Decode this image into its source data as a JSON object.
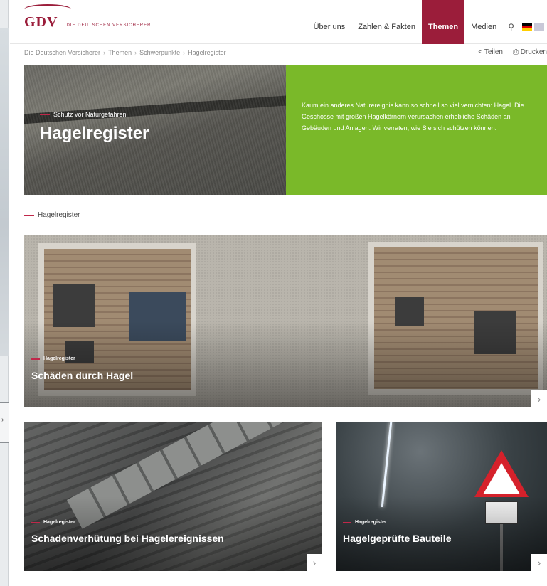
{
  "header": {
    "logo_text": "GDV",
    "logo_sub": "Die Deutschen Versicherer",
    "nav": [
      "Über uns",
      "Zahlen & Fakten",
      "Themen",
      "Medien"
    ],
    "active_nav": "Themen",
    "icons": [
      "search-icon",
      "flag-de-icon",
      "flag-uk-icon"
    ]
  },
  "breadcrumb": [
    "Die Deutschen Versicherer",
    "Themen",
    "Schwerpunkte",
    "Hagelregister"
  ],
  "actions": {
    "share": "Teilen",
    "print": "Drucken"
  },
  "hero": {
    "kicker": "Schutz vor Naturgefahren",
    "title": "Hagelregister",
    "text": "Kaum ein anderes Naturereignis kann so schnell so viel vernichten: Hagel. Die Geschosse mit großen Hagelkörnern verursachen erhebliche Schäden an Gebäuden und Anlagen. Wir verraten, wie Sie sich schützen können."
  },
  "section_label": "Hagelregister",
  "cards": [
    {
      "kicker": "Hagelregister",
      "title": "Schäden durch Hagel"
    },
    {
      "kicker": "Hagelregister",
      "title": "Schadenverhütung bei Hagelereignissen"
    },
    {
      "kicker": "Hagelregister",
      "title": "Hagelgeprüfte Bauteile"
    }
  ],
  "colors": {
    "brand": "#9b1d3a",
    "accent_green": "#7ab929",
    "dash": "#c0284a"
  }
}
